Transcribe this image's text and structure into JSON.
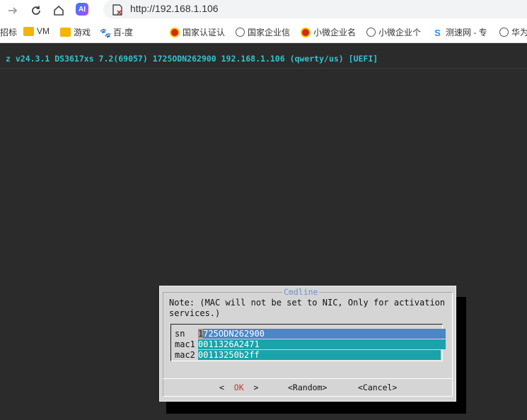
{
  "browser": {
    "url": "http://192.168.1.106",
    "ai_badge": "AI",
    "bookmarks": [
      {
        "label": "招标",
        "icon": "bookmark-icon"
      },
      {
        "label": "VM",
        "icon": "folder-icon"
      },
      {
        "label": "游戏",
        "icon": "folder-icon"
      },
      {
        "label": "百-度",
        "icon": "paw-icon"
      },
      {
        "label": "国家认证认",
        "icon": "emblem-icon"
      },
      {
        "label": "国家企业信",
        "icon": "globe-icon"
      },
      {
        "label": "小微企业名",
        "icon": "emblem-icon"
      },
      {
        "label": "小微企业个",
        "icon": "globe-icon"
      },
      {
        "label": "测速网 - 专",
        "icon": "speed-icon"
      },
      {
        "label": "华为",
        "icon": "globe-icon"
      }
    ]
  },
  "terminal": {
    "header": "z v24.3.1 DS3617xs 7.2(69057) 1725ODN262900 192.168.1.106 (qwerty/us) [UEFI]"
  },
  "dialog": {
    "title": "Cmdline",
    "note": "Note: (MAC will not be set to NIC, Only for activation\nservices.)",
    "fields": [
      {
        "label": "sn",
        "value": "1725ODN262900"
      },
      {
        "label": "mac1",
        "value": "0011326A2471"
      },
      {
        "label": "mac2",
        "value": "00113250b2ff"
      }
    ],
    "buttons": {
      "ok": "OK",
      "random": "<Random>",
      "cancel": "<Cancel>"
    }
  },
  "colors": {
    "terminal_bg": "#2b2b2b",
    "header_text": "#33c3ce",
    "dialog_bg": "#d5d5d5",
    "field_active": "#4a86c8",
    "field_inactive": "#1aa3a8",
    "title_color": "#6f93c7",
    "hotkey": "#c0392b"
  }
}
